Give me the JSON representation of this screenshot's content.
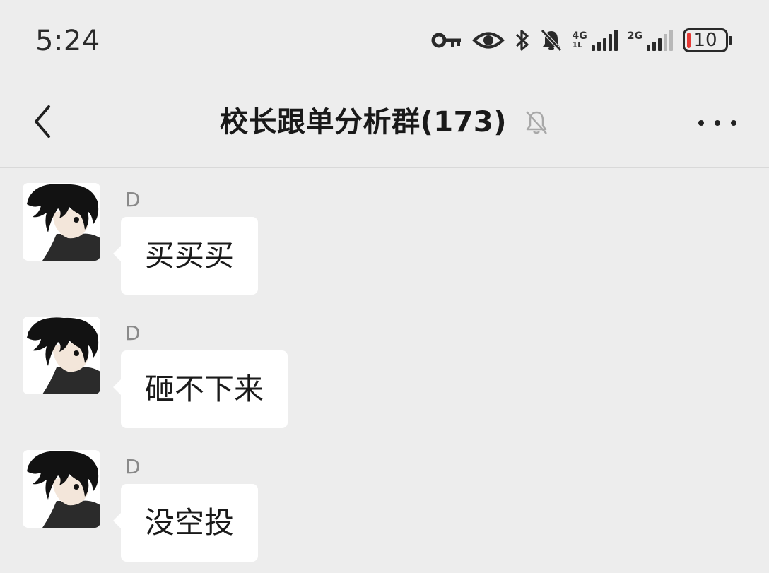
{
  "status_bar": {
    "time": "5:24",
    "network_primary": "4G",
    "network_primary_sub": "1L",
    "network_secondary": "2G",
    "battery_level": "10",
    "battery_fraction": 0.1,
    "icons": [
      "key-icon",
      "eye-icon",
      "bluetooth-icon",
      "bell-muted-icon",
      "signal-4g-icon",
      "signal-2g-icon",
      "battery-icon"
    ],
    "battery_color": "#e53935"
  },
  "header": {
    "title": "校长跟单分析群(173)",
    "back_icon": "chevron-left-icon",
    "mute_icon": "bell-muted-icon",
    "more_icon": "more-dots-icon"
  },
  "messages": [
    {
      "sender": "D",
      "text": "买买买"
    },
    {
      "sender": "D",
      "text": "砸不下来"
    },
    {
      "sender": "D",
      "text": "没空投"
    }
  ],
  "colors": {
    "background": "#ededed",
    "bubble": "#ffffff",
    "sender_name": "#8a8a8a"
  }
}
